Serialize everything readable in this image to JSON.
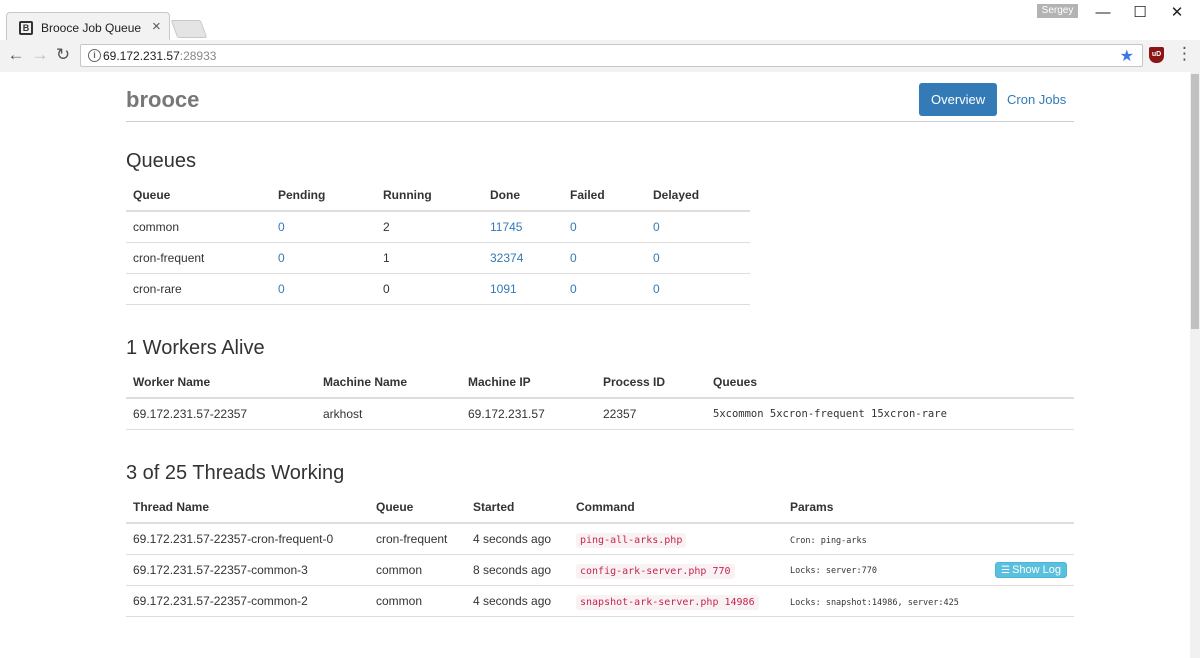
{
  "browser": {
    "tab_title": "Brooce Job Queue",
    "tab_favicon": "B",
    "tab_close": "×",
    "profile_name": "Sergey",
    "url_host": "69.172.231.57",
    "url_port": ":28933",
    "controls": {
      "minimize": "—",
      "maximize": "☐",
      "close": "✕"
    },
    "nav": {
      "back": "←",
      "forward": "→",
      "reload": "↻"
    },
    "star": "★",
    "extension_label": "uD",
    "menu": "⋮"
  },
  "header": {
    "brand": "brooce",
    "nav": [
      {
        "label": "Overview",
        "active": true
      },
      {
        "label": "Cron Jobs",
        "active": false
      }
    ]
  },
  "queues": {
    "heading": "Queues",
    "columns": [
      "Queue",
      "Pending",
      "Running",
      "Done",
      "Failed",
      "Delayed"
    ],
    "rows": [
      {
        "queue": "common",
        "pending": "0",
        "running": "2",
        "done": "11745",
        "failed": "0",
        "delayed": "0"
      },
      {
        "queue": "cron-frequent",
        "pending": "0",
        "running": "1",
        "done": "32374",
        "failed": "0",
        "delayed": "0"
      },
      {
        "queue": "cron-rare",
        "pending": "0",
        "running": "0",
        "done": "1091",
        "failed": "0",
        "delayed": "0"
      }
    ]
  },
  "workers": {
    "heading": "1 Workers Alive",
    "columns": [
      "Worker Name",
      "Machine Name",
      "Machine IP",
      "Process ID",
      "Queues"
    ],
    "rows": [
      {
        "worker": "69.172.231.57-22357",
        "machine": "arkhost",
        "ip": "69.172.231.57",
        "pid": "22357",
        "queues": "5xcommon 5xcron-frequent 15xcron-rare"
      }
    ]
  },
  "threads": {
    "heading": "3 of 25 Threads Working",
    "columns": [
      "Thread Name",
      "Queue",
      "Started",
      "Command",
      "Params"
    ],
    "show_log_label": "Show Log",
    "rows": [
      {
        "thread": "69.172.231.57-22357-cron-frequent-0",
        "queue": "cron-frequent",
        "started": "4 seconds ago",
        "command": "ping-all-arks.php",
        "params": "Cron: ping-arks"
      },
      {
        "thread": "69.172.231.57-22357-common-3",
        "queue": "common",
        "started": "8 seconds ago",
        "command": "config-ark-server.php 770",
        "params": "Locks: server:770"
      },
      {
        "thread": "69.172.231.57-22357-common-2",
        "queue": "common",
        "started": "4 seconds ago",
        "command": "snapshot-ark-server.php 14986",
        "params": "Locks: snapshot:14986, server:425"
      }
    ]
  },
  "colors": {
    "primary": "#337ab7",
    "info_button": "#5bc0de",
    "code_text": "#c7254e"
  }
}
